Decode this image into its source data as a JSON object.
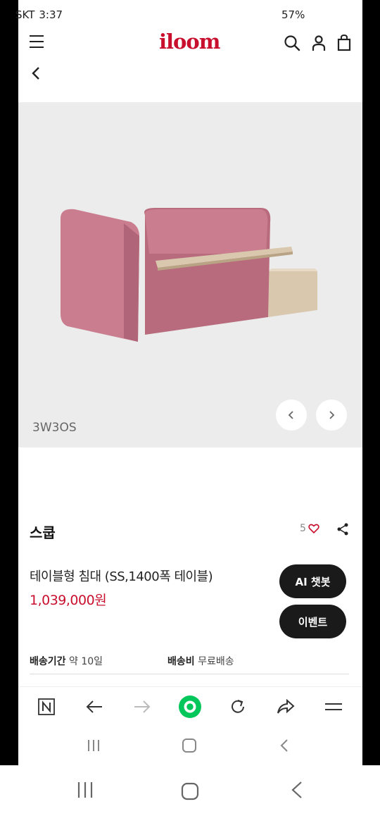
{
  "status": {
    "carrier": "SKT",
    "time": "3:37",
    "battery": "57%"
  },
  "header": {
    "logo": "iloom"
  },
  "product": {
    "sku": "3W3OS",
    "name": "스쿱",
    "like_count": "5",
    "title": "테이블형 침대 (SS,1400폭 테이블)",
    "price": "1,039,000원",
    "chatbot_label": "AI 챗봇",
    "event_label": "이벤트",
    "delivery_period_label": "배송기간",
    "delivery_period_value": "약 10일",
    "delivery_fee_label": "배송비",
    "delivery_fee_value": "무료배송"
  },
  "colors": {
    "brand": "#c8102e",
    "pill": "#1a1a1a",
    "hero_bg": "#ececec",
    "sofa": "#c97d8e",
    "wood": "#d9c7ae"
  }
}
